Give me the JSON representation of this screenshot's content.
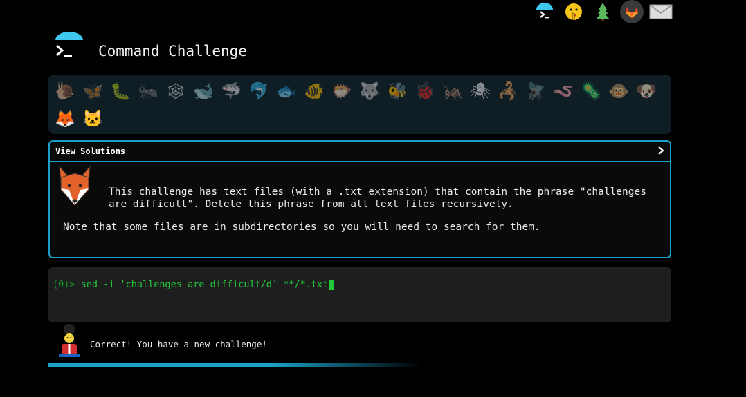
{
  "header": {
    "title": "Command Challenge",
    "top_icons": [
      "terminal-icon",
      "shushing-face-icon",
      "tree-icon",
      "gitlab-icon",
      "mail-icon"
    ]
  },
  "animals": [
    "snail",
    "butterfly",
    "caterpillar",
    "ant",
    "spider-web",
    "whale",
    "shark",
    "dolphin",
    "fish",
    "tropical-fish",
    "blowfish",
    "wolf",
    "bee",
    "ladybug",
    "cricket",
    "spider",
    "scorpion",
    "fly",
    "worm",
    "microbe",
    "monkey",
    "dog",
    "fox",
    "cat"
  ],
  "animal_glyphs": [
    "🐌",
    "🦋",
    "🐛",
    "🐜",
    "🕸",
    "🐋",
    "🦈",
    "🐬",
    "🐟",
    "🐠",
    "🐡",
    "🐺",
    "🐝",
    "🐞",
    "🦗",
    "🕷",
    "🦂",
    "🪰",
    "🪱",
    "🦠",
    "🐵",
    "🐶",
    "🦊",
    "🐱"
  ],
  "solutions": {
    "label": "View Solutions",
    "description": "This challenge has text files (with a .txt extension) that contain the phrase \"challenges are difficult\". Delete this phrase from all text files recursively.",
    "note": "Note that some files are in subdirectories so you will need to search for them."
  },
  "terminal": {
    "prompt": "(0)> ",
    "command": "sed -i 'challenges are difficult/d' **/*.txt"
  },
  "result": {
    "message": "Correct! You have a new challenge!"
  },
  "colors": {
    "accent": "#1aa0c8",
    "terminal_green": "#22c83c",
    "panel_bg": "#0f1d24"
  }
}
